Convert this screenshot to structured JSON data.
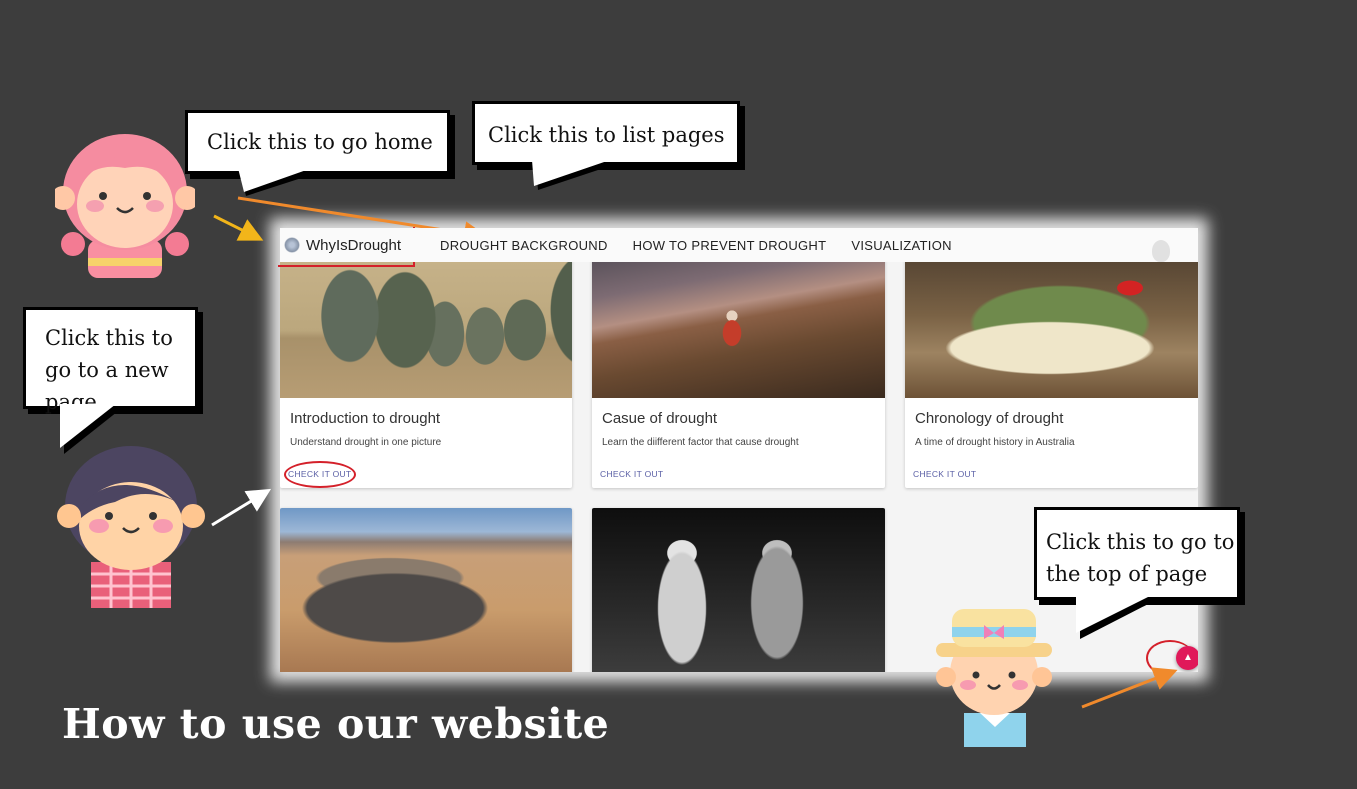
{
  "slide_title": "How to use our website",
  "callouts": {
    "home": "Click this to go home",
    "list_pages": "Click this to list pages",
    "new_page": "Click this to go to a new page",
    "top_page": "Click this to go to the top of page"
  },
  "website": {
    "brand": "WhyIsDrought",
    "nav": [
      "DROUGHT BACKGROUND",
      "HOW TO PREVENT DROUGHT",
      "VISUALIZATION"
    ],
    "cards": [
      {
        "title": "Introduction to drought",
        "description": "Understand drought in one picture",
        "link": "CHECK IT OUT"
      },
      {
        "title": "Casue of drought",
        "description": "Learn the diifferent factor that cause drought",
        "link": "CHECK IT OUT"
      },
      {
        "title": "Chronology of drought",
        "description": "A time of drought history in Australia",
        "link": "CHECK IT OUT"
      }
    ],
    "scroll_top_icon": "chevron-up-icon"
  },
  "colors": {
    "background": "#3d3d3d",
    "highlight": "#d4202a",
    "scroll_button": "#e0195a",
    "link": "#5a5fa5"
  }
}
